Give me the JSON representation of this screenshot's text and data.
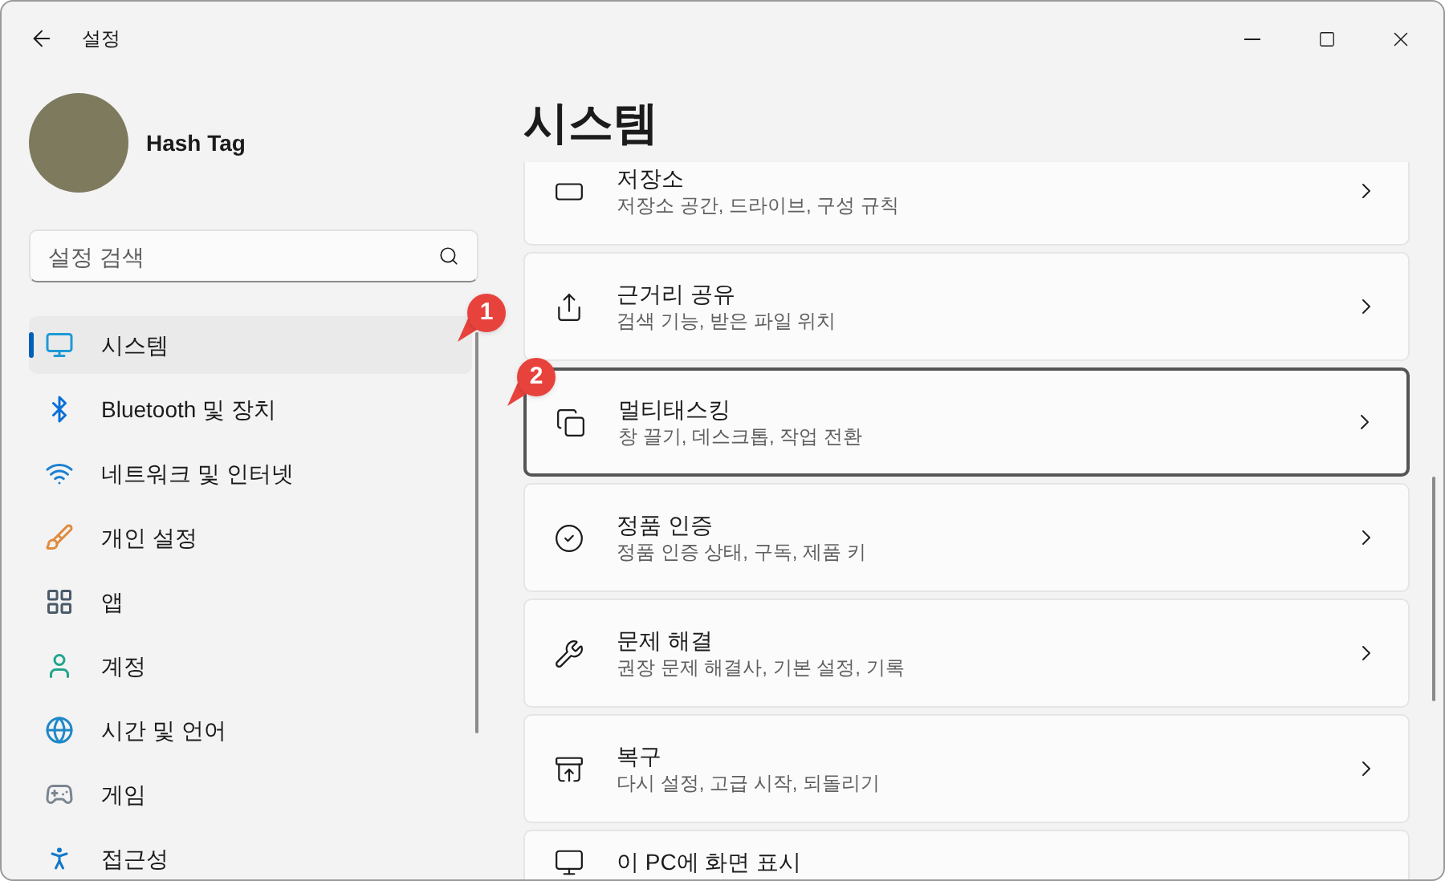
{
  "window": {
    "title": "설정"
  },
  "profile": {
    "name": "Hash Tag"
  },
  "search": {
    "placeholder": "설정 검색"
  },
  "nav": [
    {
      "label": "시스템",
      "selected": true
    },
    {
      "label": "Bluetooth 및 장치",
      "selected": false
    },
    {
      "label": "네트워크 및 인터넷",
      "selected": false
    },
    {
      "label": "개인 설정",
      "selected": false
    },
    {
      "label": "앱",
      "selected": false
    },
    {
      "label": "계정",
      "selected": false
    },
    {
      "label": "시간 및 언어",
      "selected": false
    },
    {
      "label": "게임",
      "selected": false
    },
    {
      "label": "접근성",
      "selected": false
    }
  ],
  "page": {
    "title": "시스템"
  },
  "cards": [
    {
      "title": "저장소",
      "subtitle": "저장소 공간, 드라이브, 구성 규칙",
      "selected": false
    },
    {
      "title": "근거리 공유",
      "subtitle": "검색 기능, 받은 파일 위치",
      "selected": false
    },
    {
      "title": "멀티태스킹",
      "subtitle": "창 끌기, 데스크톱, 작업 전환",
      "selected": true
    },
    {
      "title": "정품 인증",
      "subtitle": "정품 인증 상태, 구독, 제품 키",
      "selected": false
    },
    {
      "title": "문제 해결",
      "subtitle": "권장 문제 해결사, 기본 설정, 기록",
      "selected": false
    },
    {
      "title": "복구",
      "subtitle": "다시 설정, 고급 시작, 되돌리기",
      "selected": false
    },
    {
      "title": "이 PC에 화면 표시",
      "selected": false
    }
  ],
  "annotations": [
    {
      "label": "1"
    },
    {
      "label": "2"
    }
  ]
}
